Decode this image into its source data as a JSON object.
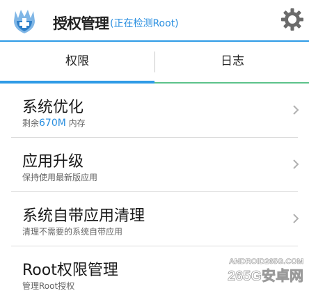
{
  "header": {
    "title": "授权管理",
    "status": "(正在检测Root)",
    "logo_icon": "shield-logo-icon",
    "settings_icon": "gear-icon"
  },
  "tabs": [
    {
      "label": "权限",
      "active": true
    },
    {
      "label": "日志",
      "active": false
    }
  ],
  "list": {
    "items": [
      {
        "title": "系统优化",
        "sub_prefix": "剩余",
        "sub_highlight": "670M",
        "sub_suffix": " 内存"
      },
      {
        "title": "应用升级",
        "sub": "保持使用最新版应用"
      },
      {
        "title": "系统自带应用清理",
        "sub": "清理不需要的系统自带应用"
      },
      {
        "title": "Root权限管理",
        "sub": "管理Root授权"
      }
    ]
  },
  "watermark": {
    "line1": "ANDROID265G.COM",
    "line2": "265G安卓网"
  },
  "colors": {
    "accent_blue": "#2f9be6",
    "accent_green": "#5cc28a",
    "highlight_text": "#2a8fe0"
  }
}
